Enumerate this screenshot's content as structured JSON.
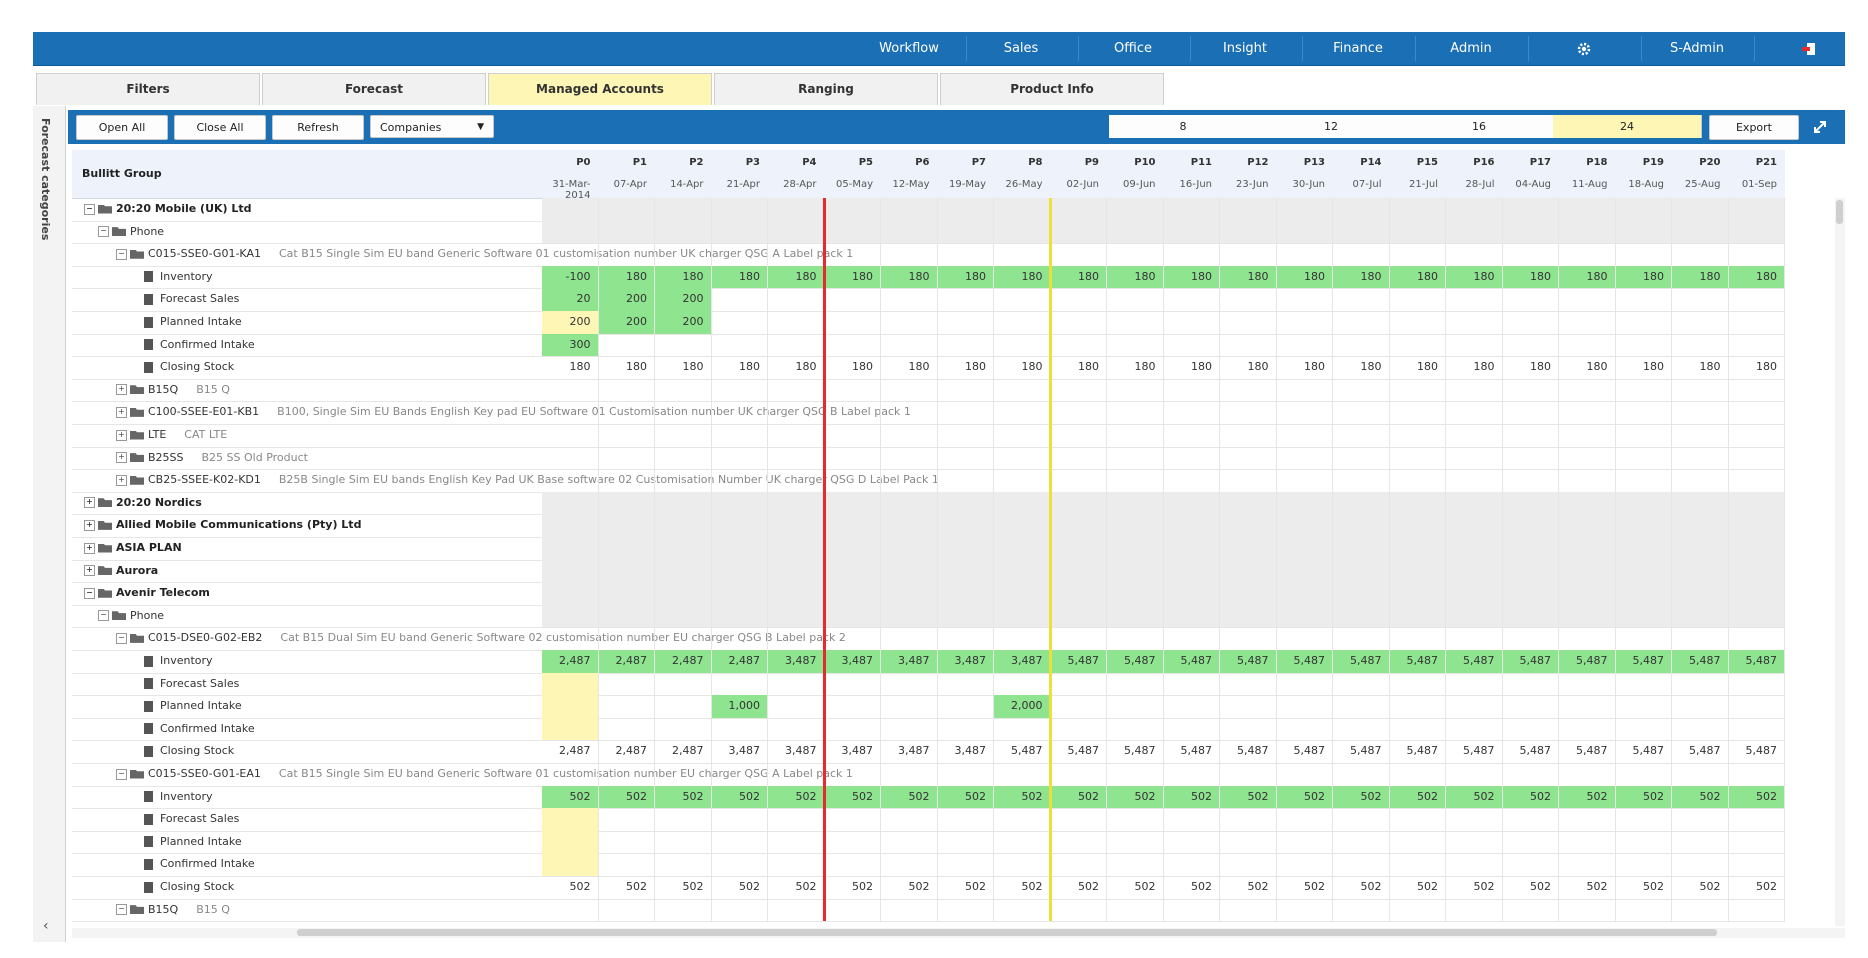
{
  "nav": {
    "items": [
      "Workflow",
      "Sales",
      "Office",
      "Insight",
      "Finance",
      "Admin",
      "S-Admin"
    ],
    "settings_icon": "gear-icon",
    "logout_icon": "logout-icon"
  },
  "tabs": {
    "items": [
      "Filters",
      "Forecast",
      "Managed Accounts",
      "Ranging",
      "Product Info"
    ],
    "active": "Managed Accounts"
  },
  "sidebar": {
    "title": "Forecast categories",
    "collapse_icon": "chevron-left-icon"
  },
  "toolbar": {
    "open_all": "Open All",
    "close_all": "Close All",
    "refresh": "Refresh",
    "dropdown_value": "Companies",
    "horizon_options": [
      "8",
      "12",
      "16",
      "24"
    ],
    "horizon_selected": "24",
    "export": "Export",
    "expand_icon": "expand-icon"
  },
  "grid": {
    "title": "Bullitt Group",
    "periods": [
      "P0",
      "P1",
      "P2",
      "P3",
      "P4",
      "P5",
      "P6",
      "P7",
      "P8",
      "P9",
      "P10",
      "P11",
      "P12",
      "P13",
      "P14",
      "P15",
      "P16",
      "P17",
      "P18",
      "P19",
      "P20",
      "P21"
    ],
    "dates": [
      "31-Mar-2014",
      "07-Apr",
      "14-Apr",
      "21-Apr",
      "28-Apr",
      "05-May",
      "12-May",
      "19-May",
      "26-May",
      "02-Jun",
      "09-Jun",
      "16-Jun",
      "23-Jun",
      "30-Jun",
      "07-Jul",
      "21-Jul",
      "28-Jul",
      "04-Aug",
      "11-Aug",
      "18-Aug",
      "25-Aug",
      "01-Sep"
    ],
    "colors": {
      "green": "#8ee48f",
      "yellow": "#fdf6b4",
      "group": "#ececec",
      "red_marker": "#e52b2b",
      "yellow_marker": "#ece13a"
    },
    "rows": [
      {
        "type": "company",
        "label": "20:20 Mobile (UK) Ltd",
        "expanded": true
      },
      {
        "type": "category",
        "label": "Phone",
        "expanded": true
      },
      {
        "type": "product",
        "label": "C015-SSE0-G01-KA1",
        "desc": "Cat B15 Single Sim EU band Generic Software 01 customisation number UK charger QSG A Label pack 1",
        "expanded": true
      },
      {
        "type": "metric",
        "label": "Inventory",
        "values": [
          "-100",
          "180",
          "180",
          "180",
          "180",
          "180",
          "180",
          "180",
          "180",
          "180",
          "180",
          "180",
          "180",
          "180",
          "180",
          "180",
          "180",
          "180",
          "180",
          "180",
          "180",
          "180"
        ],
        "fill": "green"
      },
      {
        "type": "metric",
        "label": "Forecast Sales",
        "values": [
          "20",
          "200",
          "200"
        ],
        "fill": "green"
      },
      {
        "type": "metric",
        "label": "Planned Intake",
        "values": [
          "200",
          "200",
          "200"
        ],
        "fills": [
          "yellow",
          "green",
          "green"
        ]
      },
      {
        "type": "metric",
        "label": "Confirmed Intake",
        "values": [
          "300"
        ],
        "fill": "green"
      },
      {
        "type": "metric",
        "label": "Closing Stock",
        "values": [
          "180",
          "180",
          "180",
          "180",
          "180",
          "180",
          "180",
          "180",
          "180",
          "180",
          "180",
          "180",
          "180",
          "180",
          "180",
          "180",
          "180",
          "180",
          "180",
          "180",
          "180",
          "180"
        ]
      },
      {
        "type": "product",
        "label": "B15Q",
        "desc": "B15 Q",
        "expanded": false
      },
      {
        "type": "product",
        "label": "C100-SSEE-E01-KB1",
        "desc": "B100, Single Sim EU Bands English Key pad EU Software 01 Customisation number UK charger QSG B Label pack 1",
        "expanded": false
      },
      {
        "type": "product",
        "label": "LTE",
        "desc": "CAT LTE",
        "expanded": false
      },
      {
        "type": "product",
        "label": "B25SS",
        "desc": "B25 SS Old Product",
        "expanded": false
      },
      {
        "type": "product",
        "label": "CB25-SSEE-K02-KD1",
        "desc": "B25B Single Sim EU bands English Key Pad UK Base software 02 Customisation Number UK charger QSG D Label Pack 1",
        "expanded": false
      },
      {
        "type": "company",
        "label": "20:20 Nordics",
        "expanded": false
      },
      {
        "type": "company",
        "label": "Allied Mobile Communications (Pty) Ltd",
        "expanded": false
      },
      {
        "type": "company",
        "label": "ASIA PLAN",
        "expanded": false
      },
      {
        "type": "company",
        "label": "Aurora",
        "expanded": false
      },
      {
        "type": "company",
        "label": "Avenir Telecom",
        "expanded": true
      },
      {
        "type": "category",
        "label": "Phone",
        "expanded": true
      },
      {
        "type": "product",
        "label": "C015-DSE0-G02-EB2",
        "desc": "Cat B15 Dual Sim EU band Generic Software 02 customisation number EU charger QSG B Label pack 2",
        "expanded": true
      },
      {
        "type": "metric",
        "label": "Inventory",
        "values": [
          "2,487",
          "2,487",
          "2,487",
          "2,487",
          "3,487",
          "3,487",
          "3,487",
          "3,487",
          "3,487",
          "5,487",
          "5,487",
          "5,487",
          "5,487",
          "5,487",
          "5,487",
          "5,487",
          "5,487",
          "5,487",
          "5,487",
          "5,487",
          "5,487",
          "5,487"
        ],
        "fill": "green"
      },
      {
        "type": "metric",
        "label": "Forecast Sales",
        "values": [
          ""
        ],
        "fills": [
          "yellow"
        ]
      },
      {
        "type": "metric",
        "label": "Planned Intake",
        "values": [
          "",
          "",
          "",
          "1,000",
          "",
          "",
          "",
          "",
          "2,000"
        ],
        "fills": [
          "yellow",
          "",
          "",
          "green",
          "",
          "",
          "",
          "",
          "green"
        ]
      },
      {
        "type": "metric",
        "label": "Confirmed Intake",
        "values": [
          ""
        ],
        "fills": [
          "yellow"
        ]
      },
      {
        "type": "metric",
        "label": "Closing Stock",
        "values": [
          "2,487",
          "2,487",
          "2,487",
          "3,487",
          "3,487",
          "3,487",
          "3,487",
          "3,487",
          "5,487",
          "5,487",
          "5,487",
          "5,487",
          "5,487",
          "5,487",
          "5,487",
          "5,487",
          "5,487",
          "5,487",
          "5,487",
          "5,487",
          "5,487",
          "5,487"
        ]
      },
      {
        "type": "product",
        "label": "C015-SSE0-G01-EA1",
        "desc": "Cat B15 Single Sim EU band Generic Software 01 customisation number EU charger QSG A Label pack 1",
        "expanded": true
      },
      {
        "type": "metric",
        "label": "Inventory",
        "values": [
          "502",
          "502",
          "502",
          "502",
          "502",
          "502",
          "502",
          "502",
          "502",
          "502",
          "502",
          "502",
          "502",
          "502",
          "502",
          "502",
          "502",
          "502",
          "502",
          "502",
          "502",
          "502"
        ],
        "fill": "green"
      },
      {
        "type": "metric",
        "label": "Forecast Sales",
        "values": [
          ""
        ],
        "fills": [
          "yellow"
        ]
      },
      {
        "type": "metric",
        "label": "Planned Intake",
        "values": [
          ""
        ],
        "fills": [
          "yellow"
        ]
      },
      {
        "type": "metric",
        "label": "Confirmed Intake",
        "values": [
          ""
        ],
        "fills": [
          "yellow"
        ]
      },
      {
        "type": "metric",
        "label": "Closing Stock",
        "values": [
          "502",
          "502",
          "502",
          "502",
          "502",
          "502",
          "502",
          "502",
          "502",
          "502",
          "502",
          "502",
          "502",
          "502",
          "502",
          "502",
          "502",
          "502",
          "502",
          "502",
          "502",
          "502"
        ]
      },
      {
        "type": "product",
        "label": "B15Q",
        "desc": "B15 Q",
        "expanded": true
      }
    ]
  }
}
